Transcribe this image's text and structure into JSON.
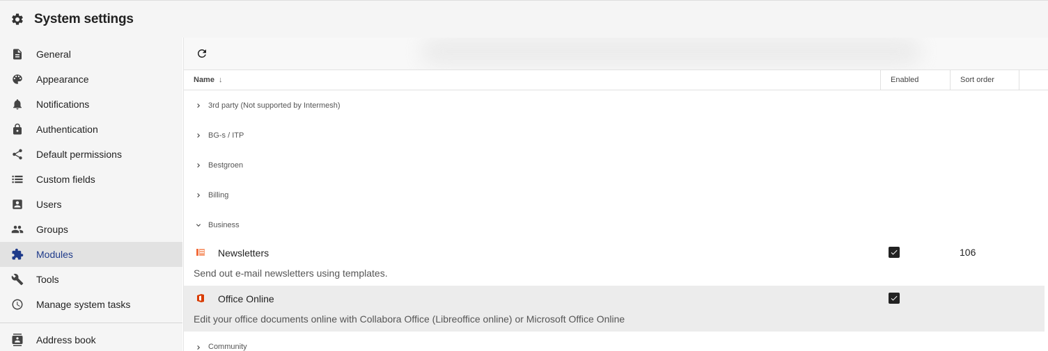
{
  "header": {
    "title": "System settings",
    "icon": "gear-icon"
  },
  "sidebar": {
    "items": [
      {
        "label": "General",
        "icon": "document-icon"
      },
      {
        "label": "Appearance",
        "icon": "palette-icon"
      },
      {
        "label": "Notifications",
        "icon": "bell-icon"
      },
      {
        "label": "Authentication",
        "icon": "lock-icon"
      },
      {
        "label": "Default permissions",
        "icon": "share-icon"
      },
      {
        "label": "Custom fields",
        "icon": "list-icon"
      },
      {
        "label": "Users",
        "icon": "account-box-icon"
      },
      {
        "label": "Groups",
        "icon": "people-icon"
      },
      {
        "label": "Modules",
        "icon": "puzzle-icon",
        "active": true
      },
      {
        "label": "Tools",
        "icon": "wrench-icon"
      },
      {
        "label": "Manage system tasks",
        "icon": "clock-icon"
      }
    ],
    "after_divider": [
      {
        "label": "Address book",
        "icon": "contacts-icon"
      }
    ]
  },
  "toolbar": {
    "refresh_icon": "refresh-icon"
  },
  "grid": {
    "columns": {
      "name": "Name",
      "name_sort_indicator": "↓",
      "enabled": "Enabled",
      "sort_order": "Sort order"
    },
    "groups_before": [
      "3rd party (Not supported by Intermesh)",
      "BG-s / ITP",
      "Bestgroen",
      "Billing"
    ],
    "expanded_group": "Business",
    "modules": [
      {
        "name": "Newsletters",
        "description": "Send out e-mail newsletters using templates.",
        "enabled": true,
        "sort_order": "106",
        "icon": "newsletter-icon"
      },
      {
        "name": "Office Online",
        "description": "Edit your office documents online with Collabora Office (Libreoffice online) or Microsoft Office Online",
        "enabled": true,
        "sort_order": "",
        "icon": "office-icon"
      }
    ],
    "groups_after": [
      "Community"
    ]
  },
  "colors": {
    "active_nav_text": "#1e3a8a",
    "active_nav_bg": "#e2e2e2",
    "sidebar_bg": "#f5f5f5",
    "newsletter_icon": "#f26b3a",
    "office_icon": "#d83b01"
  }
}
